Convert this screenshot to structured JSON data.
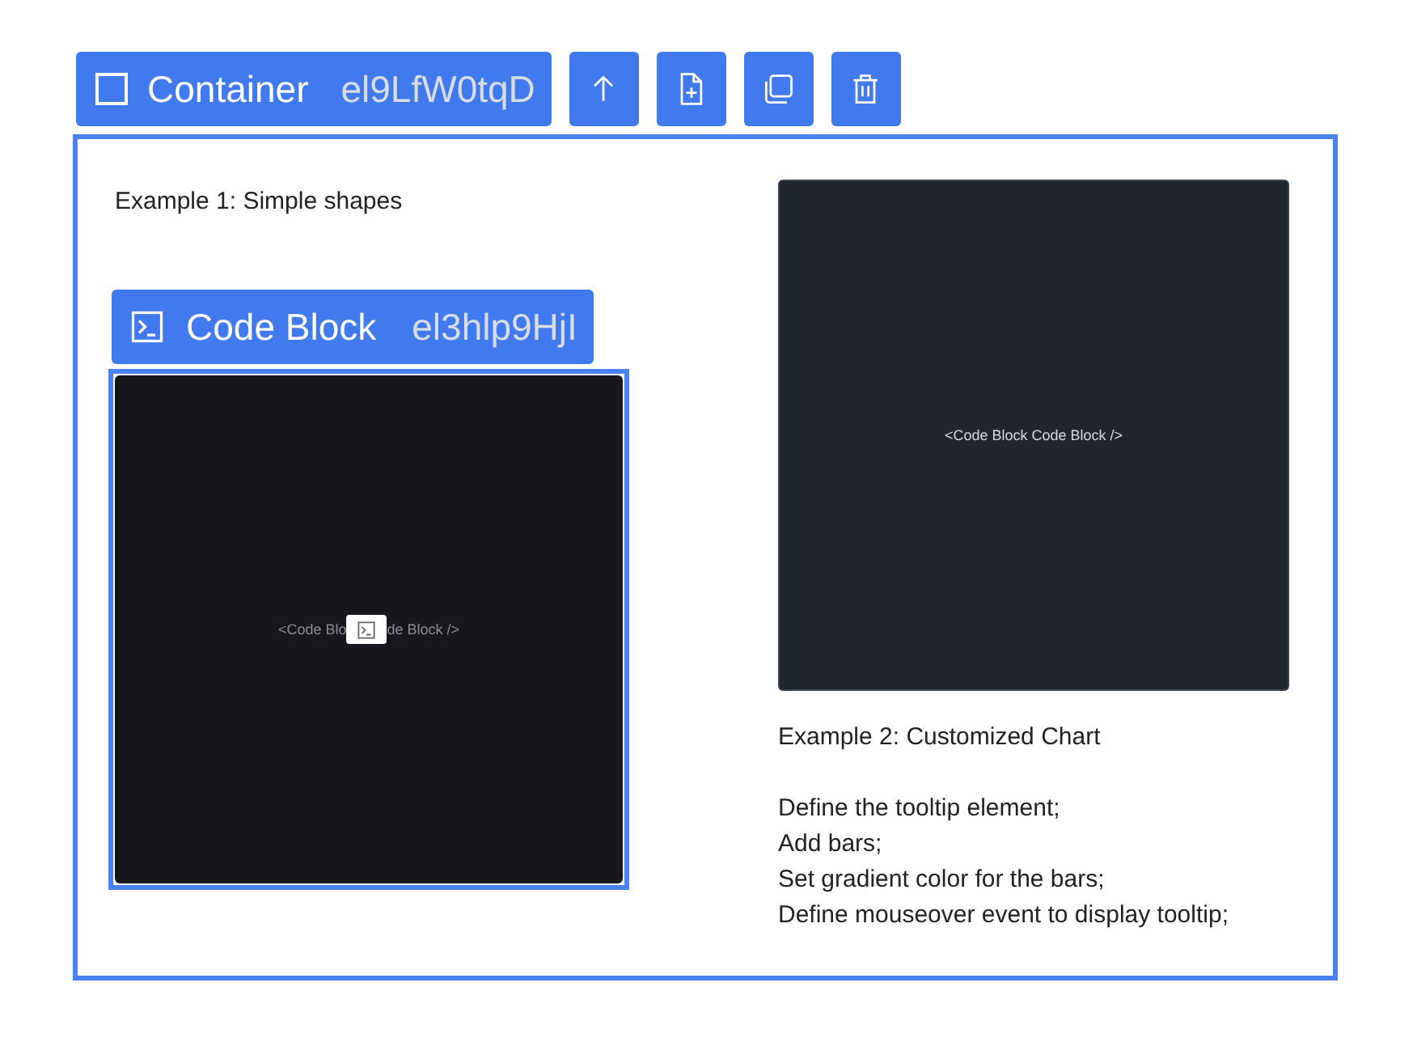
{
  "toolbar": {
    "element_type": "Container",
    "element_id": "el9LfW0tqD",
    "actions": [
      {
        "kind": "up"
      },
      {
        "kind": "add"
      },
      {
        "kind": "duplicate"
      },
      {
        "kind": "delete"
      }
    ]
  },
  "left": {
    "heading": "Example 1: Simple shapes",
    "selection": {
      "element_type": "Code Block",
      "element_id": "el3hlp9HjI"
    },
    "code_block": {
      "text_before": "<Code Blo",
      "text_after": "de Block />",
      "selected": true
    }
  },
  "right": {
    "code_block": {
      "text": "<Code Block Code Block />",
      "selected": false
    },
    "heading": "Example 2: Customized Chart",
    "lines": [
      "Define the tooltip element;",
      "Add bars;",
      "Set gradient color for the bars;",
      "Define mouseover event to display tooltip;"
    ]
  }
}
